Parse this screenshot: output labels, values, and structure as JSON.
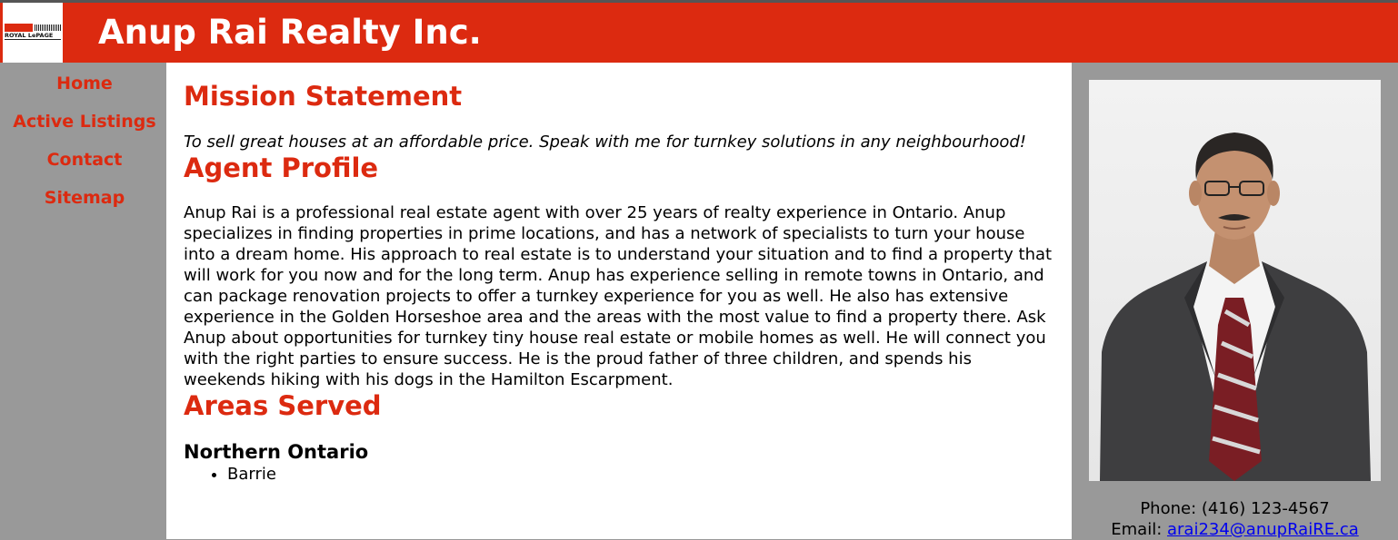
{
  "header": {
    "logo_text": "ROYAL LePAGE",
    "title": "Anup Rai Realty Inc."
  },
  "nav": {
    "items": [
      {
        "label": "Home"
      },
      {
        "label": "Active Listings"
      },
      {
        "label": "Contact"
      },
      {
        "label": "Sitemap"
      }
    ]
  },
  "main": {
    "mission_heading": "Mission Statement",
    "mission_text": "To sell great houses at an affordable price. Speak with me for turnkey solutions in any neighbourhood!",
    "profile_heading": "Agent Profile",
    "profile_text": "Anup Rai is a professional real estate agent with over 25 years of realty experience in Ontario. Anup specializes in finding properties in prime locations, and has a network of specialists to turn your house into a dream home. His approach to real estate is to understand your situation and to find a property that will work for you now and for the long term. Anup has experience selling in remote towns in Ontario, and can package renovation projects to offer a turnkey experience for you as well. He also has extensive experience in the Golden Horseshoe area and the areas with the most value to find a property there. Ask Anup about opportunities for turnkey tiny house real estate or mobile homes as well. He will connect you with the right parties to ensure success. He is the proud father of three children, and spends his weekends hiking with his dogs in the Hamilton Escarpment.",
    "areas_heading": "Areas Served",
    "regions": [
      {
        "name": "Northern Ontario",
        "towns": [
          "Barrie"
        ]
      }
    ]
  },
  "sidebar": {
    "phone": "Phone: (416) 123-4567",
    "email_label": "Email: ",
    "email": "arai234@anupRaiRE.ca"
  },
  "colors": {
    "brand_red": "#dc2a10",
    "sidebar_gray": "#999999",
    "link_blue": "#0000ee"
  }
}
